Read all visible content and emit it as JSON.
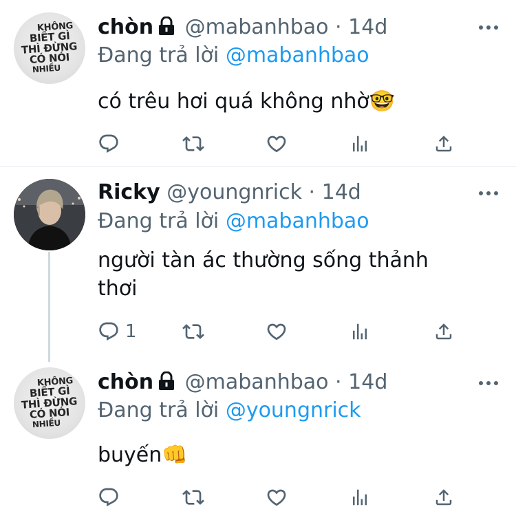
{
  "tweets": [
    {
      "name": "chòn",
      "handle": "@mabanhbao",
      "dot": "·",
      "time": "14d",
      "reply_prefix": "Đang trả lời",
      "reply_to": "@mabanhbao",
      "text": "có trêu hơi quá không nhờ🤓",
      "reply_count": "",
      "avatar_text": [
        "KHÔNG",
        "BIẾT GÌ",
        "THÌ ĐỪNG",
        "CÓ NÓI",
        "NHIỀU"
      ]
    },
    {
      "name": "Ricky",
      "handle": "@youngnrick",
      "dot": "·",
      "time": "14d",
      "reply_prefix": "Đang trả lời",
      "reply_to": "@mabanhbao",
      "text": "người tàn ác thường sống thảnh thơi",
      "reply_count": "1"
    },
    {
      "name": "chòn",
      "handle": "@mabanhbao",
      "dot": "·",
      "time": "14d",
      "reply_prefix": "Đang trả lời",
      "reply_to": "@youngnrick",
      "text": "buyến👊",
      "reply_count": "",
      "avatar_text": [
        "KHÔNG",
        "BIẾT GÌ",
        "THÌ ĐỪNG",
        "CÓ NÓI",
        "NHIỀU"
      ]
    }
  ],
  "icons": {
    "lock": "lock-icon",
    "reply": "reply-icon",
    "retweet": "retweet-icon",
    "like": "heart-icon",
    "views": "views-icon",
    "share": "share-icon",
    "more": "more-icon"
  },
  "colors": {
    "mention": "#1d9bf0",
    "secondary_text": "#536471",
    "primary_text": "#0f1419"
  }
}
